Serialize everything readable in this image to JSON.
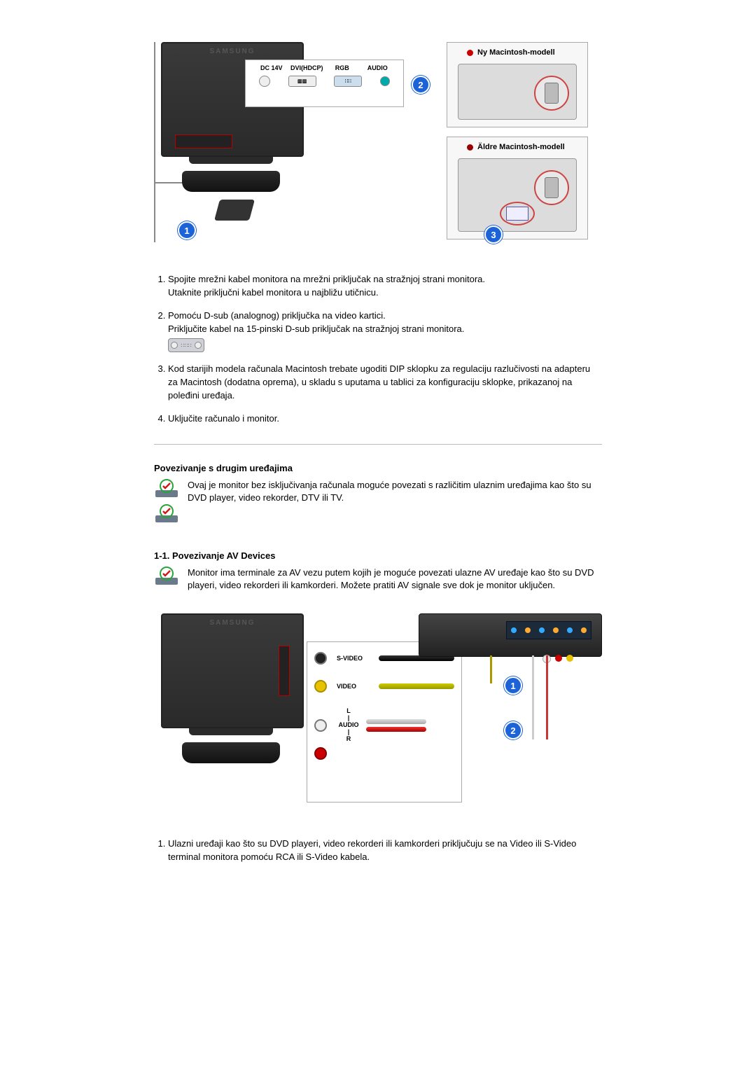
{
  "ports": {
    "dc": "DC 14V",
    "dvi": "DVI(HDCP)",
    "rgb": "RGB",
    "audio": "AUDIO"
  },
  "mac": {
    "new": "Ny Macintosh-modell",
    "old": "Äldre Macintosh-modell"
  },
  "nums": {
    "one": "1",
    "two": "2",
    "three": "3"
  },
  "steps1": {
    "s1a": "Spojite mrežni kabel monitora na mrežni priključak na stražnjoj strani monitora.",
    "s1b": "Utaknite priključni kabel monitora u najbližu utičnicu.",
    "s2a": "Pomoću D-sub (analognog) priključka na video kartici.",
    "s2b": "Priključite kabel na 15-pinski D-sub priključak na stražnjoj strani monitora.",
    "s3": "Kod starijih modela računala Macintosh trebate ugoditi DIP sklopku za regulaciju razlučivosti na adapteru za Macintosh (dodatna oprema), u skladu s uputama u tablici za konfiguraciju sklopke, prikazanoj na poleđini uređaja.",
    "s4": "Uključite računalo i monitor."
  },
  "sec2": {
    "title": "Povezivanje s drugim uređajima",
    "body": "Ovaj je monitor bez isključivanja računala moguće povezati s različitim ulaznim uređajima kao što su DVD player, video rekorder, DTV ili TV."
  },
  "sec3": {
    "title": "1-1. Povezivanje AV Devices",
    "body": "Monitor ima terminale za AV vezu putem kojih je moguće povezati ulazne AV uređaje kao što su DVD playeri, video rekorderi ili kamkorderi. Možete pratiti AV signale sve dok je monitor uključen."
  },
  "av": {
    "svideo": "S-VIDEO",
    "video": "VIDEO",
    "audio_l": "L",
    "audio_sep": "|",
    "audio": "AUDIO",
    "audio_r": "R"
  },
  "steps2": {
    "s1": "Ulazni uređaji kao što su DVD playeri, video rekorderi ili kamkorderi priključuju se na Video ili S-Video terminal monitora pomoću RCA ili S-Video kabela."
  }
}
